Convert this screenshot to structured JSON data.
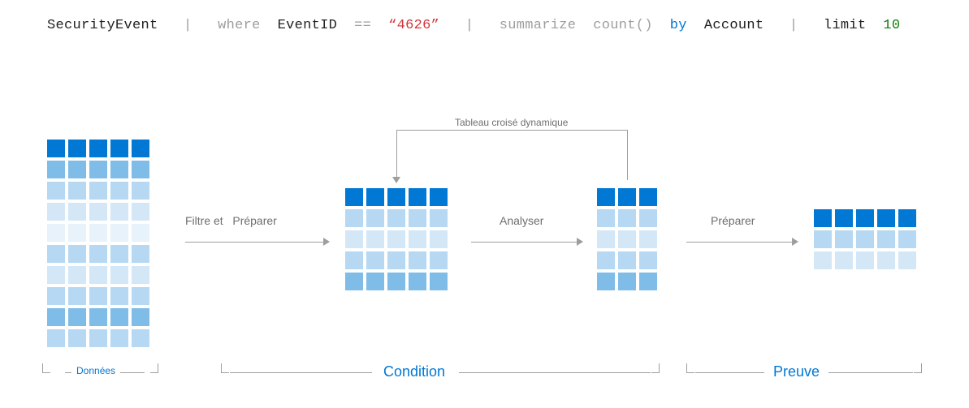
{
  "query": {
    "tokens": [
      {
        "text": "SecurityEvent",
        "class": "black"
      },
      {
        "text": "|",
        "class": "gray"
      },
      {
        "text": "where",
        "class": "gray"
      },
      {
        "text": "EventID",
        "class": "black"
      },
      {
        "text": "==",
        "class": "gray"
      },
      {
        "text": "“4626”",
        "class": "red"
      },
      {
        "text": "|",
        "class": "gray"
      },
      {
        "text": "summarize",
        "class": "gray"
      },
      {
        "text": "count()",
        "class": "gray"
      },
      {
        "text": "by",
        "class": "blue"
      },
      {
        "text": "Account",
        "class": "black"
      },
      {
        "text": "|",
        "class": "gray"
      },
      {
        "text": "limit",
        "class": "black"
      },
      {
        "text": "10",
        "class": "green"
      }
    ]
  },
  "arrows": {
    "filter_prepare_a": "Filtre et",
    "filter_prepare_b": "Préparer",
    "analyze": "Analyser",
    "prepare2": "Préparer"
  },
  "pivot_label": "Tableau croisé dynamique",
  "brackets": {
    "data": "Données",
    "condition": "Condition",
    "proof": "Preuve"
  },
  "chart_data": [
    {
      "name": "grid1_donnees",
      "type": "table",
      "cols": 5,
      "rows": 10,
      "row_shades": [
        "s1",
        "s2",
        "s3",
        "s4",
        "s5",
        "s3",
        "s4",
        "s3",
        "s2",
        "s3"
      ]
    },
    {
      "name": "grid2_filtered",
      "type": "table",
      "cols": 5,
      "rows": 5,
      "row_shades": [
        "s1",
        "s3",
        "s4",
        "s3",
        "s2"
      ]
    },
    {
      "name": "grid3_summarized",
      "type": "table",
      "cols": 3,
      "rows": 5,
      "row_shades": [
        "s1",
        "s3",
        "s4",
        "s3",
        "s2"
      ]
    },
    {
      "name": "grid4_result",
      "type": "table",
      "cols": 5,
      "rows": 3,
      "row_shades": [
        "s1",
        "s3",
        "s4"
      ]
    }
  ]
}
